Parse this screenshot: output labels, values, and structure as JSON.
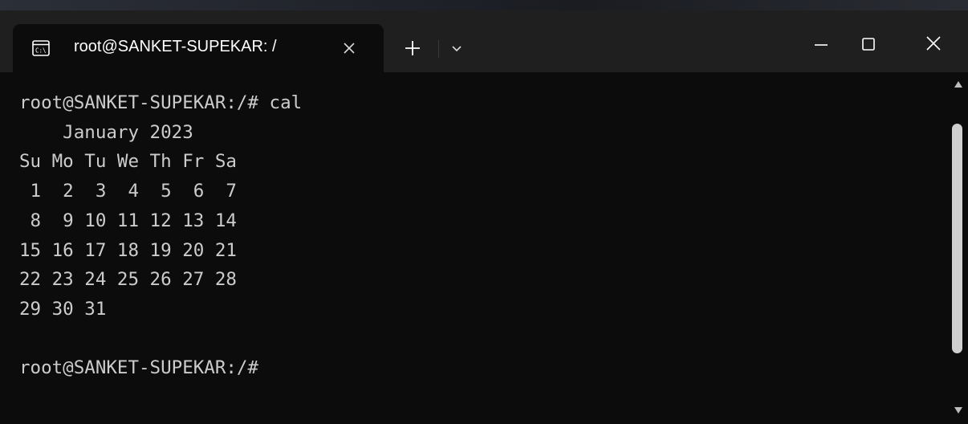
{
  "tab": {
    "title": "root@SANKET-SUPEKAR: /",
    "icon": "terminal-icon"
  },
  "titlebar": {
    "new_tab_icon": "plus-icon",
    "dropdown_icon": "chevron-down-icon",
    "minimize_icon": "minimize-icon",
    "maximize_icon": "maximize-icon",
    "close_icon": "close-icon"
  },
  "terminal": {
    "lines": [
      "root@SANKET-SUPEKAR:/# cal",
      "    January 2023",
      "Su Mo Tu We Th Fr Sa",
      " 1  2  3  4  5  6  7",
      " 8  9 10 11 12 13 14",
      "15 16 17 18 19 20 21",
      "22 23 24 25 26 27 28",
      "29 30 31",
      "",
      "root@SANKET-SUPEKAR:/#"
    ]
  },
  "colors": {
    "background": "#0c0c0c",
    "titlebar": "#1f1f1f",
    "text": "#cccccc",
    "scroll_thumb": "#cfcfcf"
  }
}
